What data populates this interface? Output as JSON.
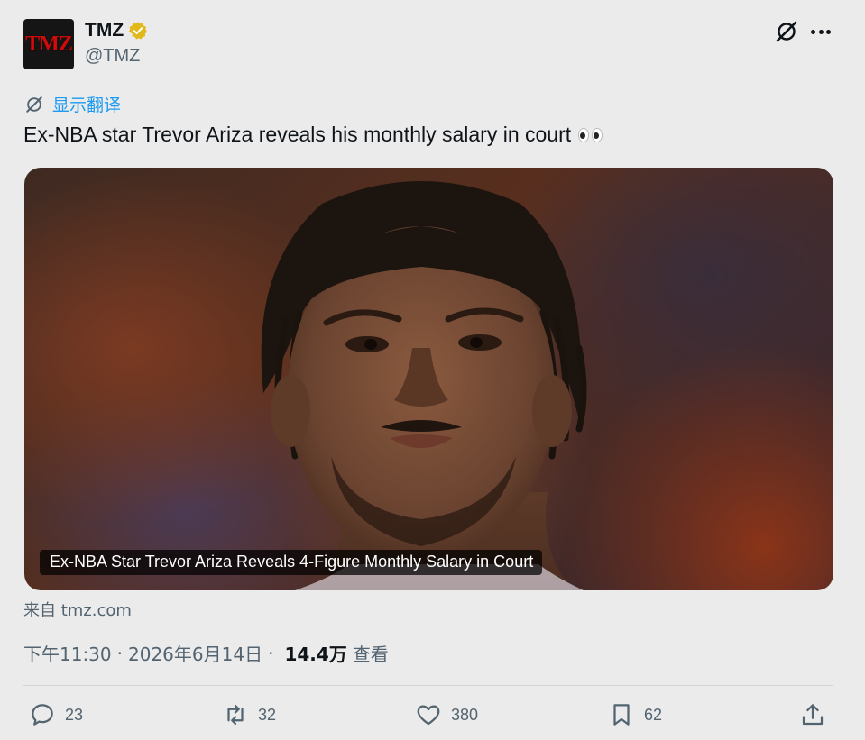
{
  "author": {
    "avatar_text": "TMZ",
    "display_name": "TMZ",
    "handle": "@TMZ",
    "verified_color": "#e2b719"
  },
  "translate": {
    "label": "显示翻译"
  },
  "tweet": {
    "text": "Ex-NBA star Trevor Ariza reveals his monthly salary in court"
  },
  "card": {
    "caption": "Ex-NBA Star Trevor Ariza Reveals 4-Figure Monthly Salary in Court",
    "source": "来自 tmz.com"
  },
  "meta": {
    "time": "下午11:30",
    "date": "2026年6月14日",
    "separator": "·",
    "views_count": "14.4万",
    "views_label": "查看"
  },
  "actions": {
    "reply_count": "23",
    "retweet_count": "32",
    "like_count": "380",
    "bookmark_count": "62"
  },
  "colors": {
    "accent": "#1d9bf0",
    "secondary_text": "#536471",
    "primary_text": "#0f1419"
  }
}
